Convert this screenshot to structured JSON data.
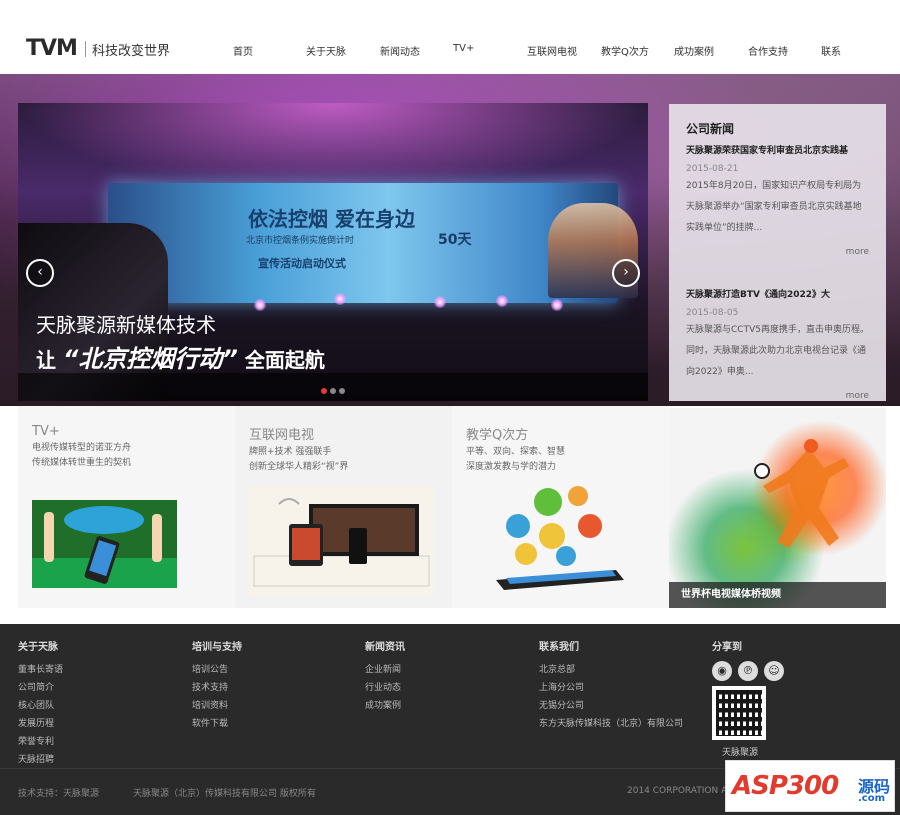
{
  "header": {
    "logo": "TVM",
    "slogan": "科技改变世界",
    "nav": [
      "首页",
      "关于天脉",
      "新闻动态",
      "TV+",
      "互联网电视",
      "教学Q次方",
      "成功案例",
      "合作支持",
      "联系"
    ]
  },
  "banner": {
    "screen_title": "依法控烟 爱在身边",
    "screen_subtitle": "北京市控烟条例实施倒计时",
    "screen_count": "50天",
    "screen_ceremony": "宣传活动启动仪式",
    "caption_line1": "天脉聚源新媒体技术",
    "caption_line2_prefix": "让",
    "caption_line2_highlight": "“北京控烟行动”",
    "caption_line2_suffix": "全面起航",
    "prev_arrow": "‹",
    "next_arrow": "›",
    "dots": 3,
    "active_dot": 1
  },
  "news": {
    "heading": "公司新闻",
    "items": [
      {
        "title": "天脉聚源荣获国家专利审查员北京实践基",
        "date": "2015-08-21",
        "body": "2015年8月20日，国家知识产权局专利局为天脉聚源举办“国家专利审查员北京实践基地实践单位”的挂牌...",
        "more": "more"
      },
      {
        "title": "天脉聚源打造BTV《通向2022》大",
        "date": "2015-08-05",
        "body": "天脉聚源与CCTV5再度携手，直击申奥历程。同时，天脉聚源此次助力北京电视台记录《通向2022》申奥...",
        "more": "more"
      }
    ]
  },
  "features": [
    {
      "title": "TV+",
      "lines": [
        "电视传媒转型的诺亚方舟",
        "传统媒体转世重生的契机"
      ]
    },
    {
      "title": "互联网电视",
      "lines": [
        "牌照+技术 强强联手",
        "创新全球华人精彩“视”界"
      ]
    },
    {
      "title": "教学Q次方",
      "lines": [
        "平等、双向、探索、智慧",
        "深度激发教与学的潜力"
      ]
    }
  ],
  "promo": {
    "caption": "世界杯电视媒体桥视频"
  },
  "footer": {
    "columns": [
      {
        "heading": "关于天脉",
        "links": [
          "董事长寄语",
          "公司简介",
          "核心团队",
          "发展历程",
          "荣誉专利",
          "天脉招聘"
        ]
      },
      {
        "heading": "培训与支持",
        "links": [
          "培训公告",
          "技术支持",
          "培训资料",
          "软件下载"
        ]
      },
      {
        "heading": "新闻资讯",
        "links": [
          "企业新闻",
          "行业动态",
          "成功案例"
        ]
      },
      {
        "heading": "联系我们",
        "links": [
          "北京总部",
          "上海分公司",
          "无锡分公司",
          "东方天脉传媒科技（北京）有限公司"
        ]
      }
    ],
    "share_heading": "分享到",
    "share_icons": [
      "weibo-icon",
      "pinterest-icon",
      "qq-icon"
    ],
    "share_glyphs": [
      "◉",
      "℗",
      "☺"
    ],
    "qr_label": "天脉聚源",
    "tech_support": "技术支持：天脉聚源",
    "copyright": "天脉聚源（北京）传媒科技有限公司 版权所有",
    "corp": "2014 CORPORATION A"
  },
  "badge": {
    "brand": "ASP300",
    "cn": "源码",
    "domain": ".com"
  },
  "colors": {
    "footer_bg": "#2a2a2a",
    "accent_red": "#e53a3a"
  }
}
